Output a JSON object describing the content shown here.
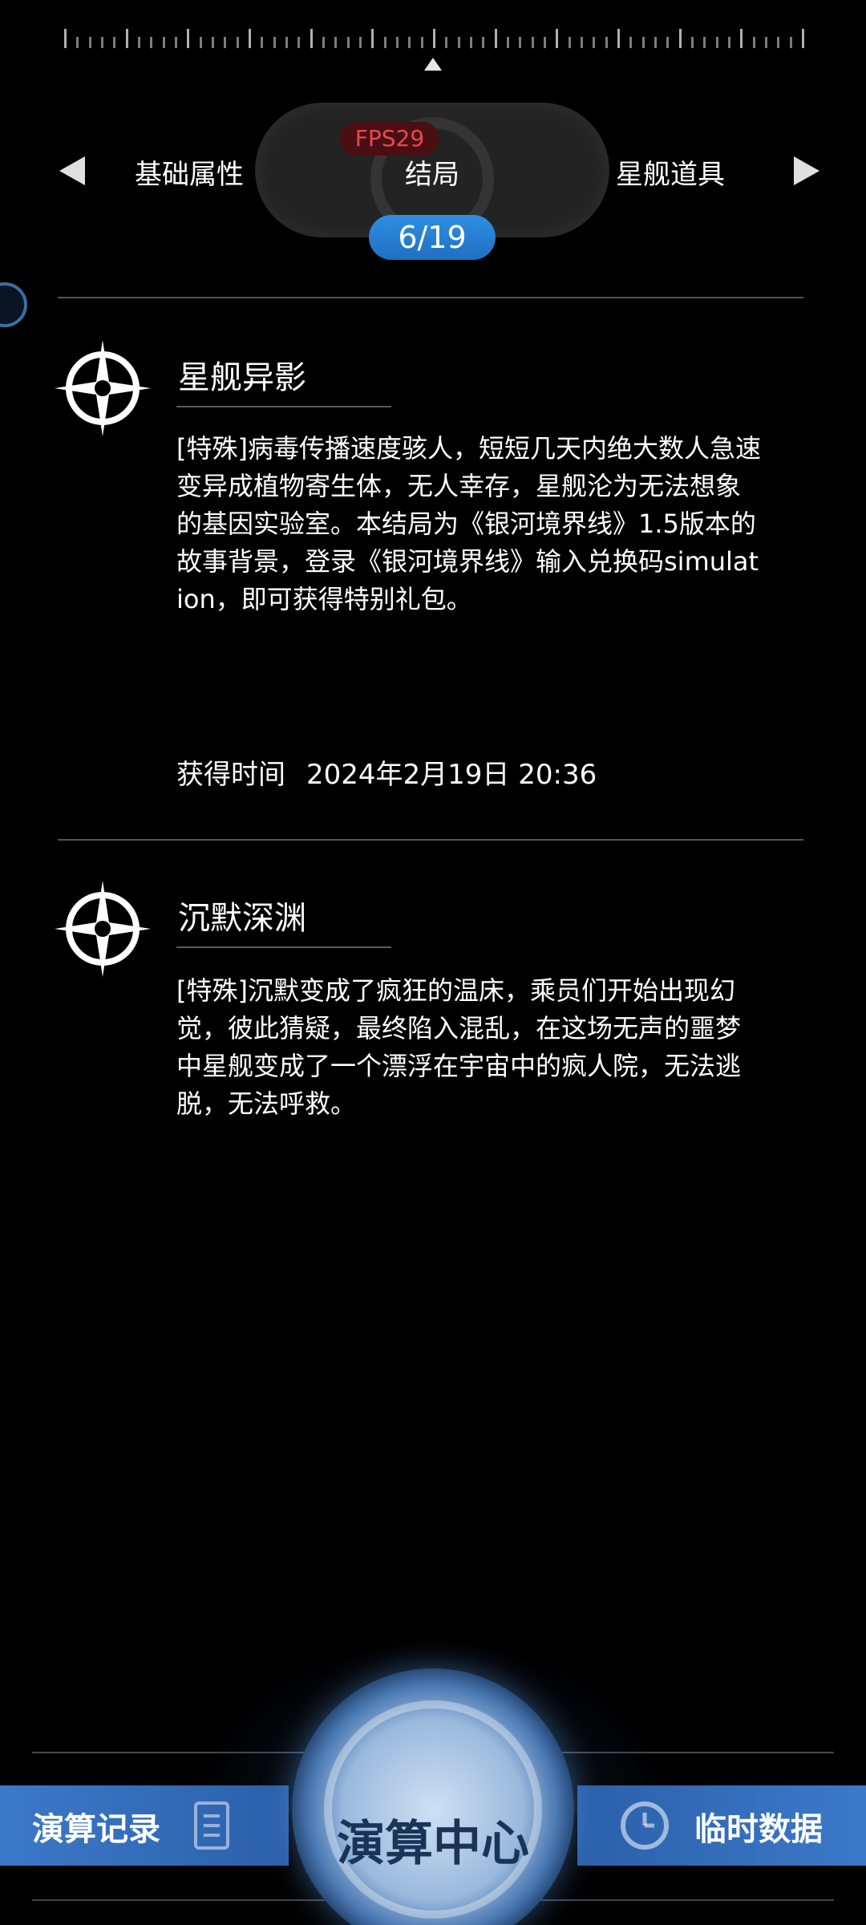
{
  "header": {
    "fps_badge": "FPS29",
    "tabs": {
      "left": "基础属性",
      "center": "结局",
      "right": "星舰道具"
    },
    "page_counter": "6/19"
  },
  "entries": [
    {
      "title": "星舰异影",
      "description": "[特殊]病毒传播速度骇人，短短几天内绝大数人急速变异成植物寄生体，无人幸存，星舰沦为无法想象的基因实验室。本结局为《银河境界线》1.5版本的故事背景，登录《银河境界线》输入兑换码simulation，即可获得特别礼包。",
      "time_label": "获得时间",
      "time_value": "2024年2月19日 20:36"
    },
    {
      "title": "沉默深渊",
      "description": "[特殊]沉默变成了疯狂的温床，乘员们开始出现幻觉，彼此猜疑，最终陷入混乱，在这场无声的噩梦中星舰变成了一个漂浮在宇宙中的疯人院，无法逃脱，无法呼救。"
    }
  ],
  "bottom_nav": {
    "left_label": "演算记录",
    "center_label": "演算中心",
    "right_label": "临时数据"
  },
  "icons": {
    "entry_icon": "compass-star-icon",
    "left_button_icon": "document-icon",
    "right_button_icon": "clock-icon"
  },
  "colors": {
    "background": "#000000",
    "accent_blue": "#2f8fe3",
    "fps_red": "#e8484f"
  }
}
